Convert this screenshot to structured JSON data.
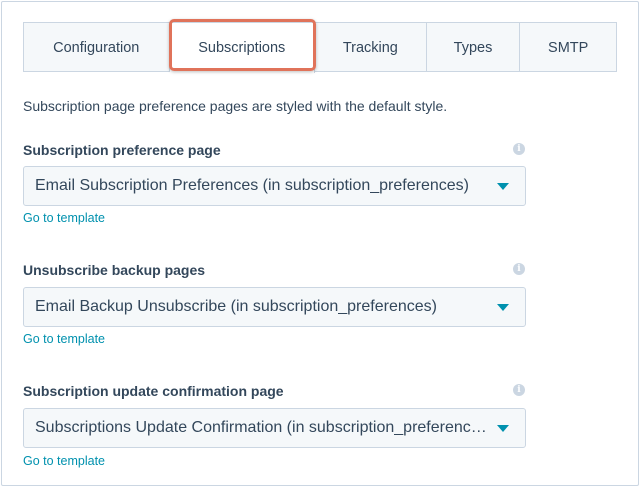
{
  "tabs": [
    {
      "label": "Configuration"
    },
    {
      "label": "Subscriptions",
      "active": true
    },
    {
      "label": "Tracking"
    },
    {
      "label": "Types"
    },
    {
      "label": "SMTP"
    }
  ],
  "intro": "Subscription page preference pages are styled with the default style.",
  "fields": [
    {
      "label": "Subscription preference page",
      "value": "Email Subscription Preferences (in subscription_preferences)",
      "link": "Go to template",
      "info_icon": "info-icon"
    },
    {
      "label": "Unsubscribe backup pages",
      "value": "Email Backup Unsubscribe (in subscription_preferences)",
      "link": "Go to template",
      "info_icon": "info-icon"
    },
    {
      "label": "Subscription update confirmation page",
      "value": "Subscriptions Update Confirmation (in subscription_preferences)",
      "link": "Go to template",
      "info_icon": "info-icon"
    }
  ],
  "colors": {
    "accent": "#0091ae",
    "highlight": "#e0735a",
    "text": "#33475b",
    "border": "#cbd6e2",
    "input_bg": "#f5f8fa"
  }
}
